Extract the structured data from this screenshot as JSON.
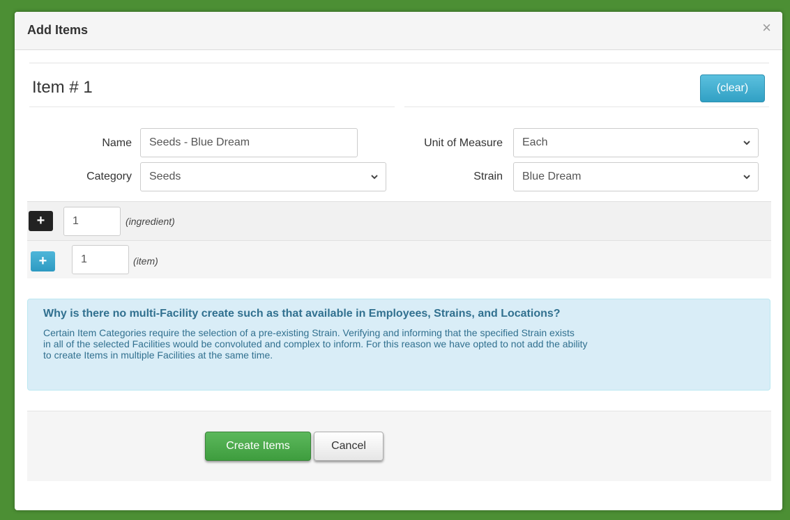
{
  "dialog": {
    "title": "Add Items",
    "close_glyph": "×"
  },
  "item": {
    "heading": "Item # 1",
    "clear_label": "(clear)",
    "fields": {
      "name": {
        "label": "Name",
        "value": "Seeds - Blue Dream"
      },
      "category": {
        "label": "Category",
        "value": "Seeds"
      },
      "unit": {
        "label": "Unit of Measure",
        "value": "Each"
      },
      "strain": {
        "label": "Strain",
        "value": "Blue Dream"
      }
    }
  },
  "ingredient": {
    "plus_glyph": "+",
    "count": "1",
    "hint": "(ingredient)"
  },
  "item_row": {
    "plus_glyph": "+",
    "count": "1",
    "hint": "(item)"
  },
  "info": {
    "question": "Why is there no multi-Facility create such as that available in Employees, Strains, and Locations?",
    "line1": "Certain Item Categories require the selection of a pre-existing Strain. Verifying and informing that the specified Strain exists",
    "line2": "in all of the selected Facilities would be convoluted and complex to inform. For this reason we have opted to not add the ability",
    "line3": "to create Items in multiple Facilities at the same time."
  },
  "footer": {
    "create_label": "Create Items",
    "cancel_label": "Cancel"
  },
  "colors": {
    "page_bg": "#4c8f34",
    "info_bg": "#d9edf7",
    "info_text": "#31708f",
    "create_btn": "#5cb85c",
    "clear_btn": "#5bc0de"
  },
  "icons": {
    "close": "close-icon",
    "chevron": "chevron-down-icon",
    "plus": "plus-icon"
  }
}
